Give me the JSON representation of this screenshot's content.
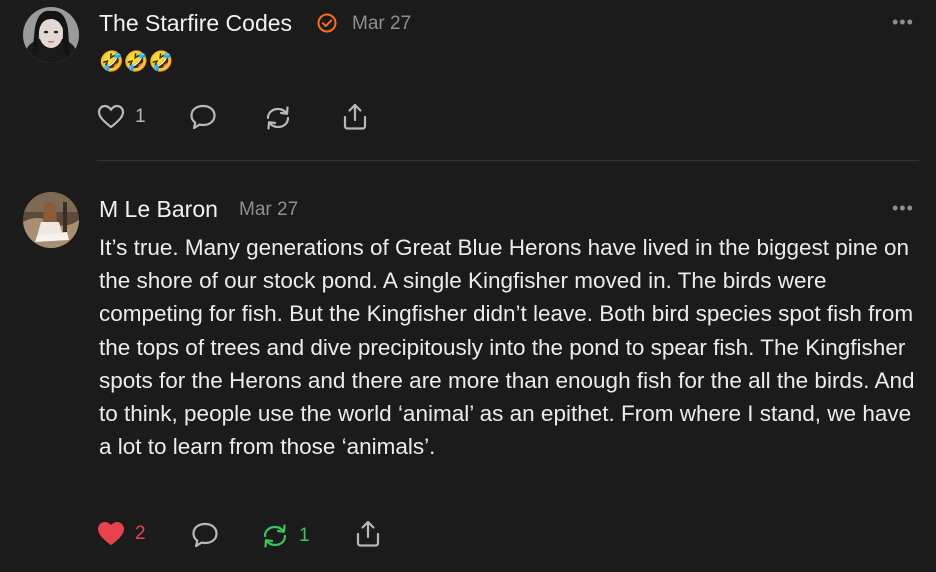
{
  "posts": [
    {
      "author": "The Starfire Codes",
      "date": "Mar 27",
      "verified": true,
      "verified_color": "#ff6a1a",
      "text": "🤣🤣🤣",
      "more_label": "•••",
      "likes": {
        "count": "1",
        "liked": false
      },
      "comments": {
        "count": ""
      },
      "restacks": {
        "count": "",
        "restacked": false
      },
      "share": true
    },
    {
      "author": "M Le Baron",
      "date": "Mar 27",
      "verified": false,
      "text": "It’s true. Many generations of Great Blue Herons have lived in the biggest pine on the shore of our stock pond. A single Kingfisher moved in. The birds were competing for fish. But the Kingfisher didn’t leave. Both bird species spot fish from the tops of trees and dive precipitously into the pond to spear fish. The Kingfisher spots for the Herons and there are more than enough fish for the all the birds. And to think, people use the world ‘animal’ as an epithet. From where I stand, we have a lot to learn from those ‘animals’.",
      "more_label": "•••",
      "likes": {
        "count": "2",
        "liked": true,
        "color": "#e8424c"
      },
      "comments": {
        "count": ""
      },
      "restacks": {
        "count": "1",
        "restacked": true,
        "color": "#34c759"
      },
      "share": true
    }
  ],
  "icons": {
    "like": "heart-icon",
    "comment": "comment-bubble-icon",
    "restack": "restack-arrows-icon",
    "share": "share-upload-icon",
    "more": "more-dots-icon",
    "verified": "verified-badge-icon"
  }
}
